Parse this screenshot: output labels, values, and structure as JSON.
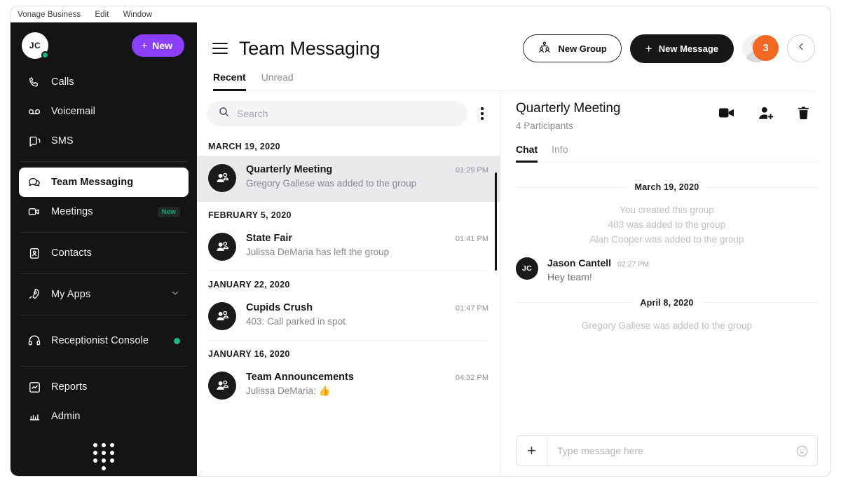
{
  "menubar": {
    "items": [
      {
        "label": "Vonage Business"
      },
      {
        "label": "Edit"
      },
      {
        "label": "Window"
      }
    ]
  },
  "sidebar": {
    "avatar_initials": "JC",
    "new_button": "New",
    "items": [
      {
        "label": "Calls",
        "icon": "phone-icon"
      },
      {
        "label": "Voicemail",
        "icon": "voicemail-icon"
      },
      {
        "label": "SMS",
        "icon": "sms-icon"
      },
      {
        "label": "Team Messaging",
        "icon": "chat-bubble-icon"
      },
      {
        "label": "Meetings",
        "icon": "video-camera-icon",
        "badge": "New"
      },
      {
        "label": "Contacts",
        "icon": "contact-card-icon"
      },
      {
        "label": "My Apps",
        "icon": "apps-rocket-icon"
      },
      {
        "label": "Receptionist Console",
        "icon": "headset-icon"
      },
      {
        "label": "Reports",
        "icon": "reports-chart-icon"
      },
      {
        "label": "Admin",
        "icon": "admin-icon"
      }
    ]
  },
  "header": {
    "title": "Team Messaging",
    "new_group_label": "New Group",
    "new_message_label": "New Message",
    "notification_count": "3",
    "tabs": [
      {
        "label": "Recent",
        "active": true
      },
      {
        "label": "Unread",
        "active": false
      }
    ]
  },
  "conversations": {
    "search_placeholder": "Search",
    "groups": [
      {
        "date": "MARCH 19, 2020",
        "items": [
          {
            "name": "Quarterly Meeting",
            "preview": "Gregory Gallese was added to the group",
            "time": "01:29 PM",
            "selected": true
          }
        ]
      },
      {
        "date": "FEBRUARY 5, 2020",
        "items": [
          {
            "name": "State Fair",
            "preview": "Julissa DeMaria has left the group",
            "time": "01:41 PM",
            "selected": false
          }
        ]
      },
      {
        "date": "JANUARY 22, 2020",
        "items": [
          {
            "name": "Cupids Crush",
            "preview": "403: Call parked in spot",
            "time": "01:47 PM",
            "selected": false
          }
        ]
      },
      {
        "date": "JANUARY 16, 2020",
        "items": [
          {
            "name": "Team Announcements",
            "preview": "Julissa DeMaria: 👍",
            "time": "04:32 PM",
            "selected": false
          }
        ]
      }
    ]
  },
  "chat": {
    "title": "Quarterly Meeting",
    "subtitle": "4 Participants",
    "tabs": [
      {
        "label": "Chat",
        "active": true
      },
      {
        "label": "Info",
        "active": false
      }
    ],
    "actions": [
      {
        "icon": "video-call-icon"
      },
      {
        "icon": "add-participant-icon"
      },
      {
        "icon": "trash-icon"
      }
    ],
    "day1": {
      "date": "March 19, 2020",
      "system_lines": [
        "You created this group",
        "403 was added to the group",
        "Alan Cooper was added to the group"
      ],
      "message": {
        "avatar_initials": "JC",
        "author": "Jason Cantell",
        "time": "02:27 PM",
        "text": "Hey team!"
      }
    },
    "day2": {
      "date": "April 8, 2020",
      "system_lines": [
        "Gregory Gallese was added to the group"
      ]
    },
    "composer_placeholder": "Type message here"
  },
  "colors": {
    "accent_purple": "#8b3ffb",
    "badge_orange": "#f26722",
    "presence_green": "#1db584",
    "sidebar_bg": "#141416",
    "dark": "#17171a"
  }
}
